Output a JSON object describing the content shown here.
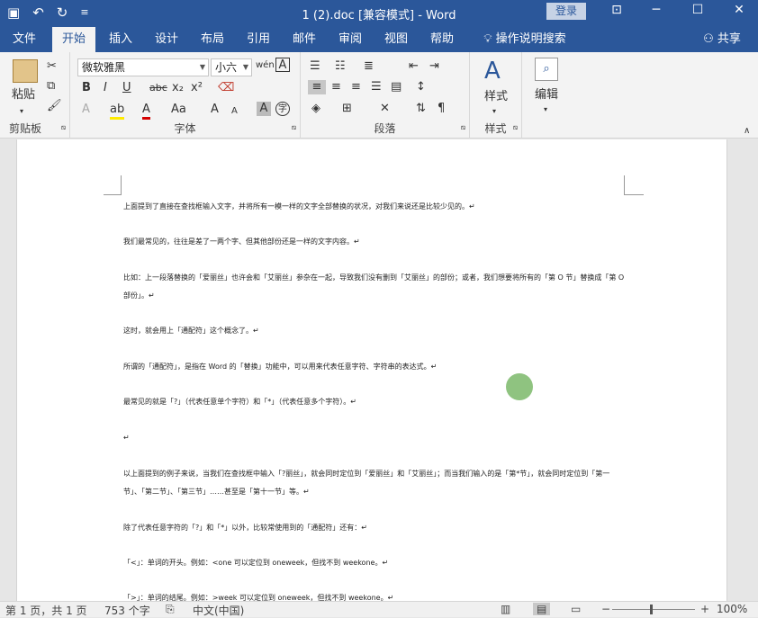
{
  "titlebar": {
    "title": "1 (2).doc [兼容模式]  -  Word",
    "login": "登录",
    "qat_save": "▣",
    "qat_undo": "↶",
    "qat_redo": "↻",
    "qat_more": "≡",
    "win_ribbon": "⊡",
    "win_min": "─",
    "win_max": "☐",
    "win_close": "✕"
  },
  "tabs": [
    "文件",
    "开始",
    "插入",
    "设计",
    "布局",
    "引用",
    "邮件",
    "审阅",
    "视图",
    "帮助"
  ],
  "tell_me": "操作说明搜索",
  "share": "共享",
  "ribbon": {
    "clipboard": {
      "label": "剪贴板",
      "paste": "粘贴"
    },
    "font": {
      "label": "字体",
      "family": "微软雅黑",
      "size": "小六",
      "bold": "B",
      "italic": "I",
      "underline": "U",
      "strike": "abc",
      "sub": "x₂",
      "sup": "x²",
      "grow": "A",
      "shrink": "A",
      "case": "Aa"
    },
    "paragraph": {
      "label": "段落"
    },
    "styles": {
      "label": "样式",
      "btn": "样式"
    },
    "editing": {
      "btn": "编辑"
    }
  },
  "document": {
    "paragraphs": [
      "上面提到了直接在查找框输入文字，并将所有一模一样的文字全部替换的状况，对我们来说还是比较少见的。↵",
      "我们最常见的，往往是差了一两个字、但其他部份还是一样的文字内容。↵",
      "比如：上一段落替换的「爱丽丝」也许会和「艾丽丝」参杂在一起，导致我们没有删到「艾丽丝」的部份；或者，我们想要将所有的「第 O 节」替换成「第 O 部份」。↵",
      "这时，就会用上「通配符」这个概念了。↵",
      "所谓的「通配符」，是指在 Word 的「替换」功能中，可以用来代表任意字符、字符串的表达式。↵",
      "最常见的就是「?」（代表任意单个字符）和「*」（代表任意多个字符）。↵",
      "↵",
      "以上面提到的例子来说，当我们在查找框中输入「?丽丝」，就会同时定位到「爱丽丝」和「艾丽丝」；而当我们输入的是「第*节」，就会同时定位到「第一节」、「第二节」、「第三节」……甚至是「第十一节」等。↵",
      "除了代表任意字符的「?」和「*」以外，比较常使用到的「通配符」还有：↵",
      "「<」：单词的开头。例如：<one 可以定位到 oneweek，但找不到 weekone。↵",
      "「>」：单词的结尾。例如：>week 可以定位到 oneweek，但找不到 weekone。↵"
    ]
  },
  "status": {
    "page": "第 1 页，共 1 页",
    "words": "753 个字",
    "lang": "中文(中国)",
    "zoom": "100%"
  }
}
